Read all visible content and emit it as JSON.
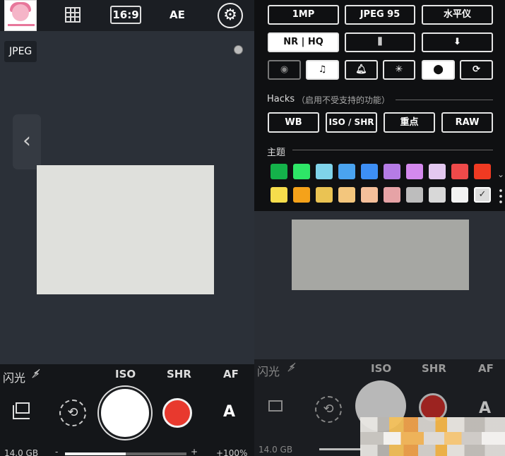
{
  "left": {
    "topbar": {
      "aspect_ratio": "16:9",
      "ae": "AE"
    },
    "format_badge": "JPEG",
    "bottom": {
      "flash_label": "闪光",
      "iso_label": "ISO",
      "shr_label": "SHR",
      "af_label": "AF",
      "mode_label": "A",
      "storage": "14.0 GB",
      "zoom_minus": "-",
      "zoom_plus": "+",
      "zoom_percent": "+100%",
      "zoom_level": 0.5
    }
  },
  "right": {
    "settings": {
      "row1": [
        "1MP",
        "JPEG 95",
        "水平仪"
      ],
      "row2": [
        "NR | HQ"
      ],
      "hacks_label": "Hacks",
      "hacks_note": "（启用不受支持的功能）",
      "hacks": [
        "WB",
        "ISO / SHR",
        "重点",
        "RAW"
      ],
      "theme_label": "主题",
      "theme_colors_row1": [
        "#14b24a",
        "#2ee667",
        "#7fd3ea",
        "#4aa3ef",
        "#3d8ff5",
        "#b57ce6",
        "#d489ee",
        "#e3c8f0",
        "#ee4a4a",
        "#f03a22"
      ],
      "theme_colors_row2": [
        "#f6dd4c",
        "#f5a21a",
        "#eac353",
        "#f3c67d",
        "#f4bf9a",
        "#e6a3a6",
        "#bdbdbd",
        "#d8d8d8",
        "#f2f2f2",
        "#dcdcdc"
      ]
    },
    "bottom": {
      "flash_label": "闪光",
      "iso_label": "ISO",
      "shr_label": "SHR",
      "af_label": "AF",
      "mode_label": "A",
      "storage": "14.0 GB"
    }
  }
}
